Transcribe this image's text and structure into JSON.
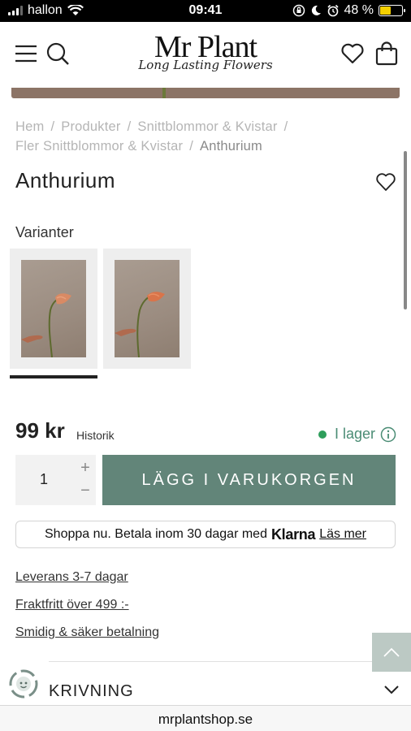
{
  "status_bar": {
    "carrier": "hallon",
    "time": "09:41",
    "battery": "48 %"
  },
  "header": {
    "logo_main": "Mr Plant",
    "logo_sub": "Long Lasting Flowers"
  },
  "breadcrumb": {
    "items": [
      "Hem",
      "Produkter",
      "Snittblommor & Kvistar",
      "Fler Snittblommor & Kvistar"
    ],
    "current": "Anthurium",
    "separator": "/"
  },
  "product": {
    "title": "Anthurium",
    "variants_label": "Varianter",
    "price": "99 kr",
    "history_label": "Historik",
    "stock_label": "I lager",
    "quantity": "1",
    "add_to_cart_label": "LÄGG I VARUKORGEN"
  },
  "klarna": {
    "text": "Shoppa nu. Betala inom 30 dagar med",
    "logo": "Klarna",
    "link": "Läs mer"
  },
  "info_links": [
    "Leverans 3-7 dagar",
    "Fraktfritt över 499 :-",
    "Smidig & säker betalning"
  ],
  "description": {
    "label": "KRIVNING"
  },
  "url_bar": {
    "url": "mrplantshop.se"
  },
  "colors": {
    "accent": "#628579",
    "stock_green": "#2e9e5b",
    "scroll_top_bg": "#bcc9c4"
  }
}
